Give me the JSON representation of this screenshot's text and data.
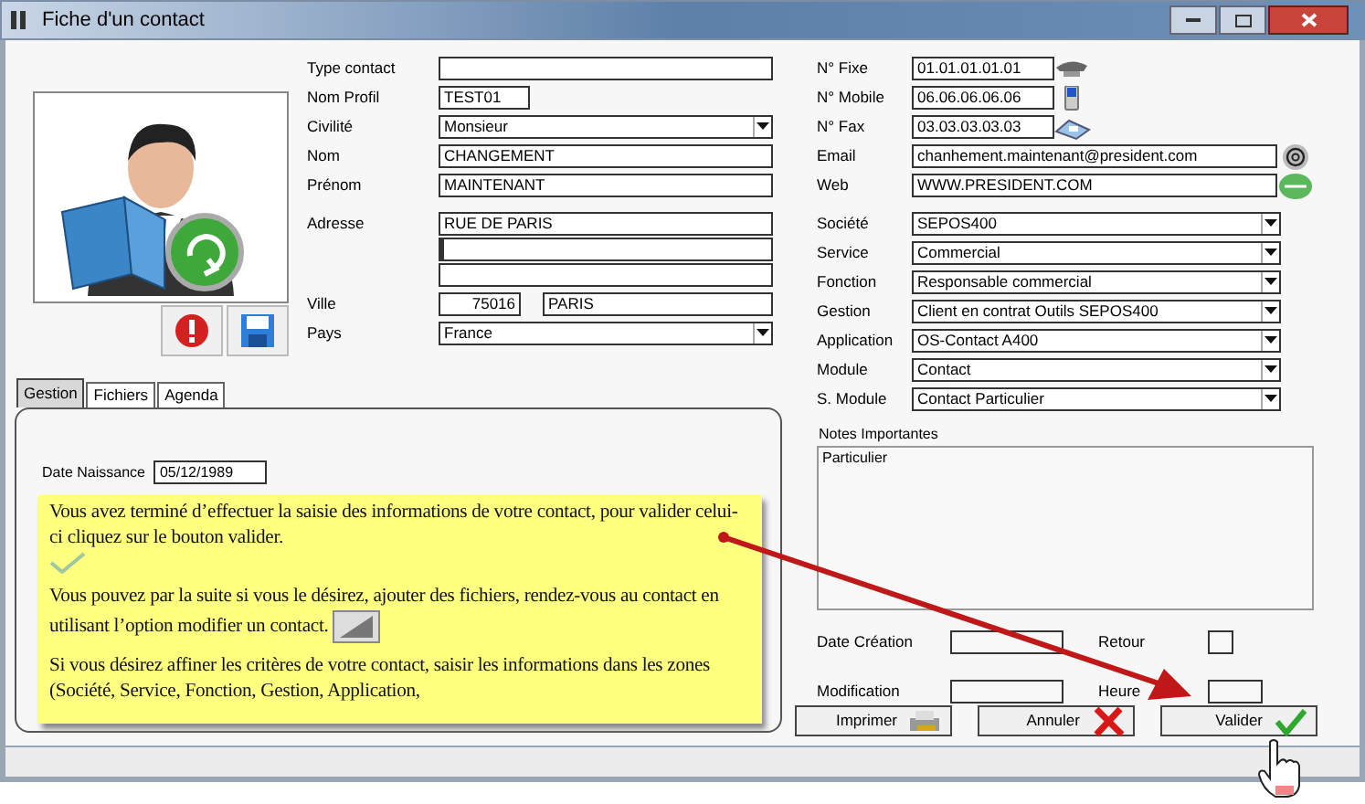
{
  "window": {
    "title": "Fiche d'un contact"
  },
  "contact_fields": [
    {
      "label": "Type contact",
      "kind": "text"
    },
    {
      "label": "Nom Profil",
      "kind": "short",
      "value": "TEST01"
    },
    {
      "label": "Civilité",
      "kind": "select",
      "value": "Monsieur"
    },
    {
      "label": "Nom",
      "kind": "text",
      "value": "CHANGEMENT"
    },
    {
      "label": "Prénom",
      "kind": "text",
      "value": "MAINTENANT"
    },
    {
      "label": "Adresse",
      "kind": "address",
      "value": "RUE DE PARIS"
    },
    {
      "label": "Ville",
      "kind": "city",
      "postcode": "75016",
      "value": "PARIS"
    },
    {
      "label": "Pays",
      "kind": "select",
      "value": "France"
    }
  ],
  "contact_info": [
    {
      "label": "N° Fixe",
      "kind": "phone",
      "value": "01.01.01.01.01"
    },
    {
      "label": "N° Mobile",
      "kind": "mobile",
      "value": "06.06.06.06.06"
    },
    {
      "label": "N° Fax",
      "kind": "fax",
      "value": "03.03.03.03.03"
    },
    {
      "label": "Email",
      "kind": "email",
      "value": "chanhement.maintenant@president.com"
    },
    {
      "label": "Web",
      "kind": "web",
      "value": "WWW.PRESIDENT.COM"
    },
    {
      "label": "Société",
      "kind": "select",
      "value": "SEPOS400"
    },
    {
      "label": "Service",
      "kind": "select",
      "value": "Commercial"
    },
    {
      "label": "Fonction",
      "kind": "select",
      "value": "Responsable commercial"
    },
    {
      "label": "Gestion",
      "kind": "select",
      "value": "Client en contrat Outils SEPOS400"
    },
    {
      "label": "Application",
      "kind": "select",
      "value": "OS-Contact A400"
    },
    {
      "label": "Module",
      "kind": "select",
      "value": "Contact"
    },
    {
      "label": "S. Module",
      "kind": "select",
      "value": "Contact Particulier"
    }
  ],
  "tabs": [
    {
      "label": "Gestion",
      "selected": true
    },
    {
      "label": "Fichiers",
      "selected": false
    },
    {
      "label": "Agenda",
      "selected": false
    }
  ],
  "gestion": {
    "birth_date": {
      "label": "Date Naissance",
      "value": "05/12/1989"
    },
    "help_note": [
      {
        "kind": "check",
        "text": "Vous avez terminé d’effectuer la saisie des informations de votre contact, pour valider celui-ci cliquez sur le bouton valider."
      },
      {
        "kind": "edit",
        "text": "Vous pouvez par la suite si vous le désirez, ajouter des fichiers, rendez-vous au contact en utilisant l’option modifier un contact."
      },
      {
        "kind": "plain",
        "text": "Si vous désirez affiner les critères de votre contact, saisir les informations dans les zones (Société, Service, Fonction, Gestion, Application,"
      }
    ]
  },
  "notes": {
    "label": "Notes Importantes",
    "value": "Particulier"
  },
  "dates": [
    {
      "label": "Date Création",
      "kind": "wide"
    },
    {
      "label": "Retour",
      "kind": "small"
    },
    {
      "label": "Modification",
      "kind": "wide"
    },
    {
      "label": "Heure",
      "kind": "medium"
    }
  ],
  "buttons": [
    {
      "label": "Imprimer",
      "kind": "print"
    },
    {
      "label": "Annuler",
      "kind": "cancel"
    },
    {
      "label": "Valider",
      "kind": "ok"
    }
  ]
}
